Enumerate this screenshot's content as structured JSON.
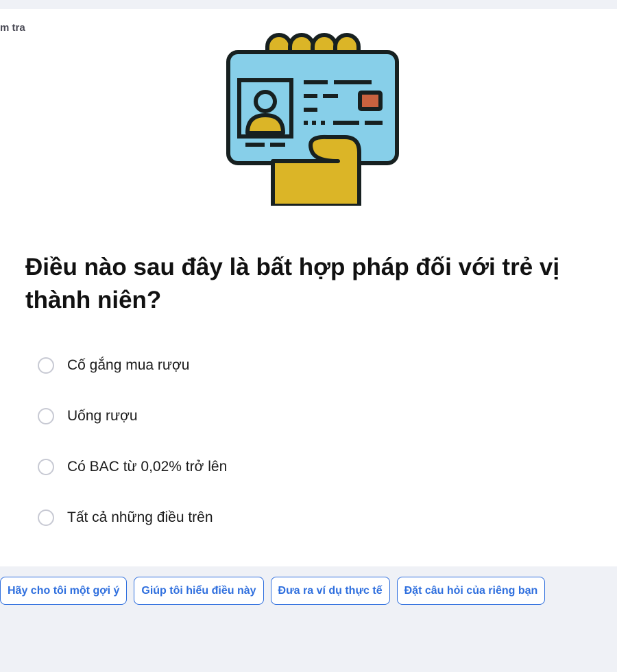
{
  "card": {
    "label": "m tra"
  },
  "illustration": {
    "icon": "id-card-in-hand-icon",
    "colors": {
      "card": "#87cfe9",
      "hand": "#dbb527",
      "outline": "#172020",
      "chip": "#c9623f"
    }
  },
  "question": {
    "text": "Điều nào sau đây là bất hợp pháp đối với trẻ vị thành niên?"
  },
  "options": [
    {
      "label": "Cố gắng mua rượu",
      "selected": false
    },
    {
      "label": "Uống rượu",
      "selected": false
    },
    {
      "label": "Có BAC từ 0,02% trở lên",
      "selected": false
    },
    {
      "label": "Tất cả những điều trên",
      "selected": false
    }
  ],
  "suggestions": [
    {
      "label": "Hãy cho tôi một gợi ý"
    },
    {
      "label": "Giúp tôi hiểu điều này"
    },
    {
      "label": "Đưa ra ví dụ thực tế"
    },
    {
      "label": "Đặt câu hỏi của riêng bạn"
    }
  ],
  "colors": {
    "accent": "#2f6fde",
    "page_background": "#eff1f6",
    "card_background": "#ffffff"
  }
}
